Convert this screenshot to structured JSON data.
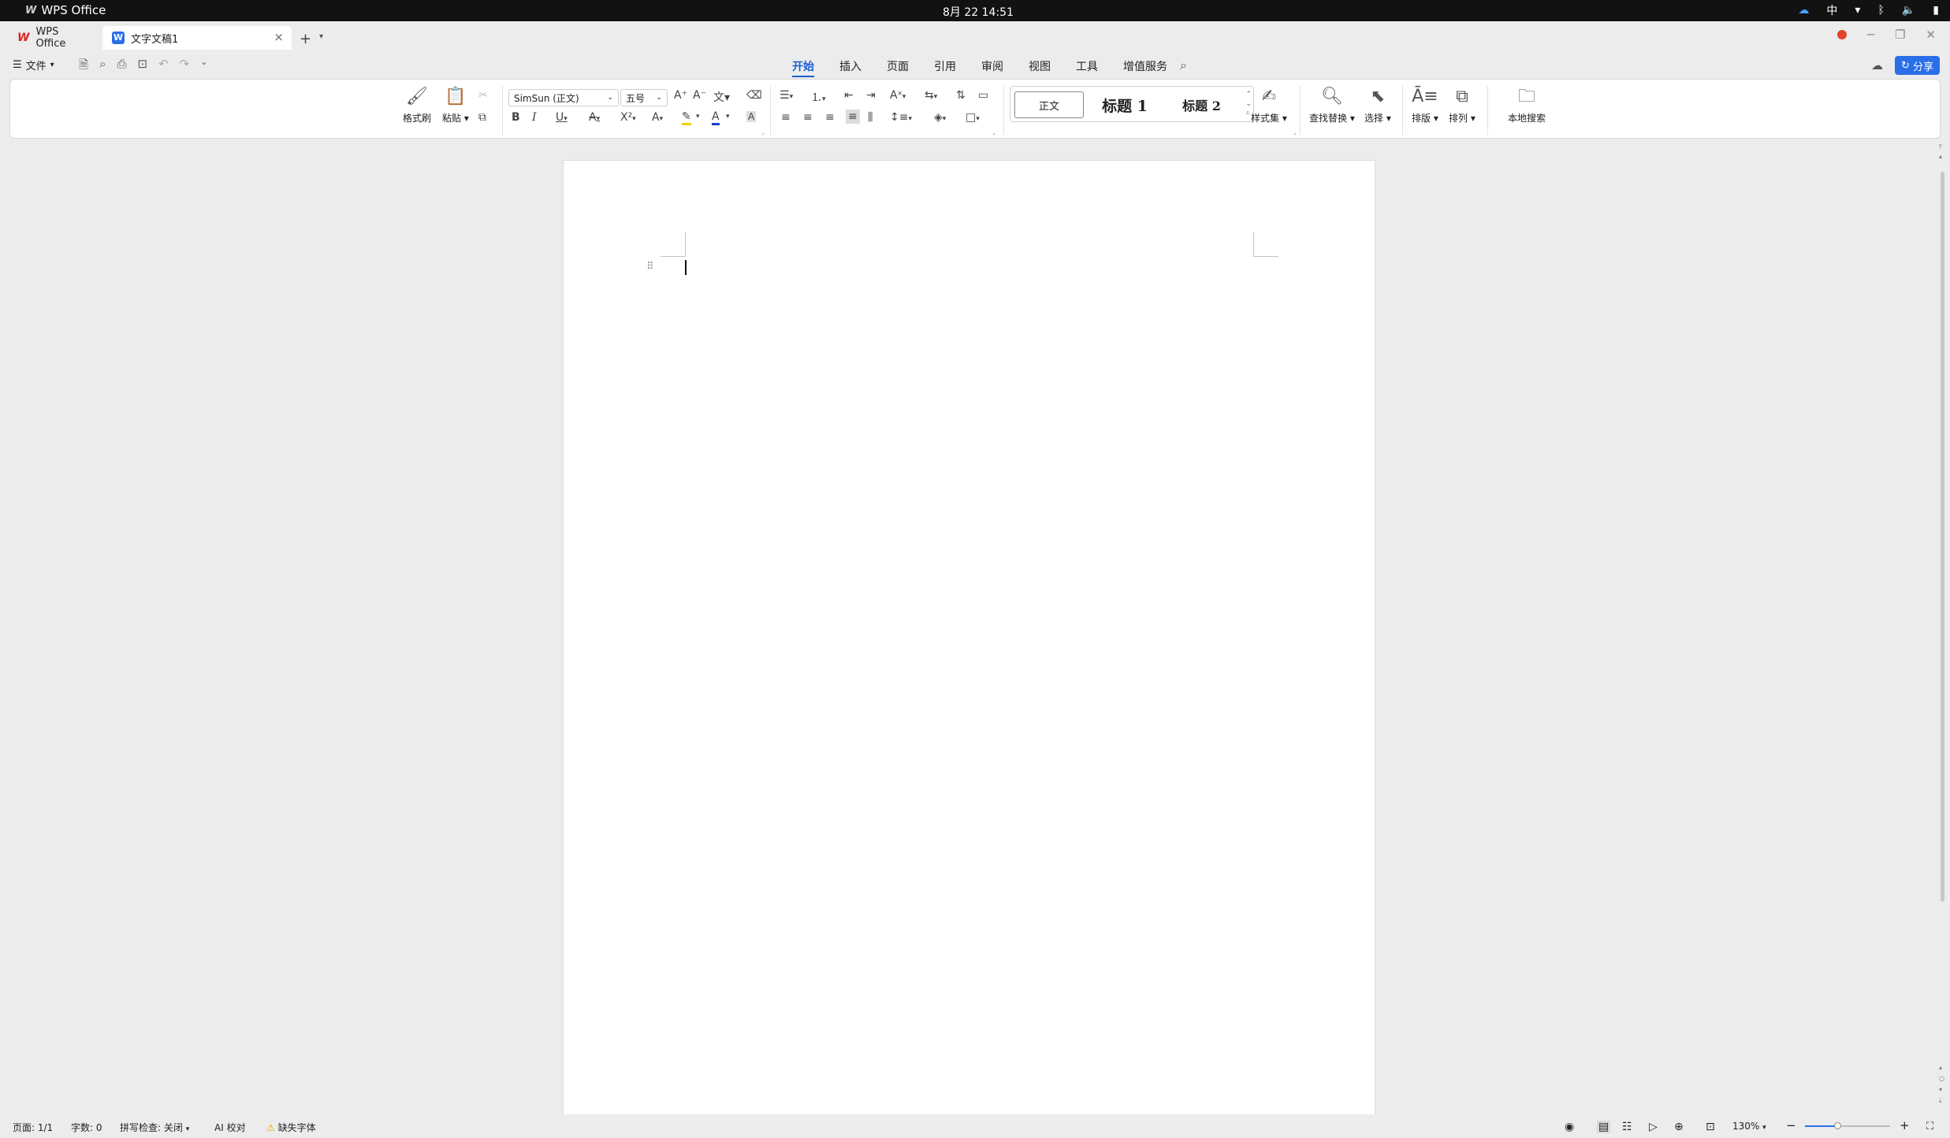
{
  "system_bar": {
    "app_name": "WPS Office",
    "datetime": "8月 22  14:51",
    "input_method": "中"
  },
  "tabs": [
    {
      "label": "WPS Office"
    },
    {
      "label": "文字文稿1"
    }
  ],
  "menu": {
    "file_label": "文件",
    "tabs": [
      "开始",
      "插入",
      "页面",
      "引用",
      "审阅",
      "视图",
      "工具",
      "增值服务"
    ],
    "active_tab": "开始",
    "share_label": "分享"
  },
  "ribbon": {
    "format_painter": "格式刷",
    "paste": "粘贴",
    "font_name": "SimSun (正文)",
    "font_size": "五号",
    "styles": {
      "body": "正文",
      "heading1": "标题  1",
      "heading2": "标题  2"
    },
    "style_set": "样式集",
    "find_replace": "查找替换",
    "select": "选择",
    "layout": "排版",
    "arrange": "排列",
    "local_search": "本地搜索"
  },
  "status_bar": {
    "page": "页面: 1/1",
    "word_count": "字数: 0",
    "spell_check": "拼写检查: 关闭",
    "ai_proofread": "AI 校对",
    "missing_fonts": "缺失字体",
    "zoom": "130%",
    "zoom_level": 0.38
  },
  "colors": {
    "accent": "#2a6ee8",
    "active_tab": "#1a5fd4",
    "font_color_bar": "#1a3bd4",
    "highlight_bar": "#f0d200"
  }
}
